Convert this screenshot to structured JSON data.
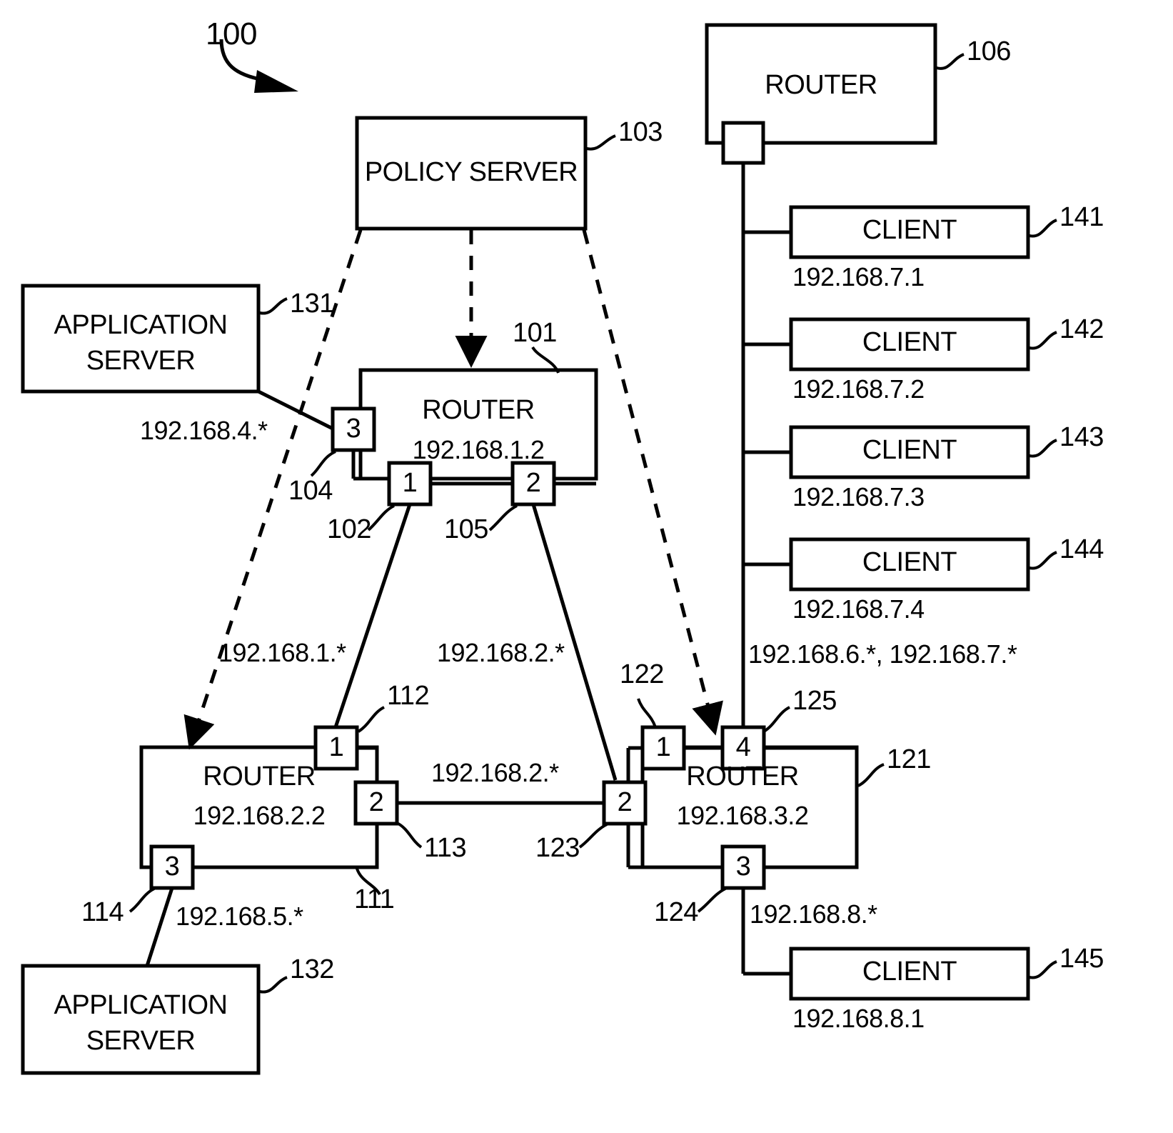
{
  "diagram": {
    "figure_ref": "100",
    "nodes": {
      "policy_server": {
        "label": "POLICY SERVER",
        "ref": "103"
      },
      "router_101": {
        "label": "ROUTER",
        "address": "192.168.1.2",
        "ref": "101"
      },
      "router_106": {
        "label": "ROUTER",
        "ref": "106"
      },
      "router_111": {
        "label": "ROUTER",
        "address": "192.168.2.2",
        "ref": "111"
      },
      "router_121": {
        "label": "ROUTER",
        "address": "192.168.3.2",
        "ref": "121"
      },
      "app_server_131": {
        "label_line1": "APPLICATION",
        "label_line2": "SERVER",
        "ref": "131"
      },
      "app_server_132": {
        "label_line1": "APPLICATION",
        "label_line2": "SERVER",
        "ref": "132"
      },
      "client_141": {
        "label": "CLIENT",
        "address": "192.168.7.1",
        "ref": "141"
      },
      "client_142": {
        "label": "CLIENT",
        "address": "192.168.7.2",
        "ref": "142"
      },
      "client_143": {
        "label": "CLIENT",
        "address": "192.168.7.3",
        "ref": "143"
      },
      "client_144": {
        "label": "CLIENT",
        "address": "192.168.7.4",
        "ref": "144"
      },
      "client_145": {
        "label": "CLIENT",
        "address": "192.168.8.1",
        "ref": "145"
      }
    },
    "ports": {
      "p104": {
        "number": "3",
        "ref": "104"
      },
      "p102": {
        "number": "1",
        "ref": "102"
      },
      "p105": {
        "number": "2",
        "ref": "105"
      },
      "p112": {
        "number": "1",
        "ref": "112"
      },
      "p113": {
        "number": "2",
        "ref": "113"
      },
      "p114": {
        "number": "3",
        "ref": "114"
      },
      "p122": {
        "number": "1",
        "ref": "122"
      },
      "p123": {
        "number": "2",
        "ref": "123"
      },
      "p124": {
        "number": "3",
        "ref": "124"
      },
      "p125": {
        "number": "4",
        "ref": "125"
      },
      "p106": {
        "number": "",
        "ref": ""
      }
    },
    "link_labels": {
      "subnet_4": "192.168.4.*",
      "subnet_1": "192.168.1.*",
      "subnet_2_left": "192.168.2.*",
      "subnet_2_mid": "192.168.2.*",
      "subnet_5": "192.168.5.*",
      "subnet_6_7": "192.168.6.*, 192.168.7.*",
      "subnet_8": "192.168.8.*"
    }
  }
}
